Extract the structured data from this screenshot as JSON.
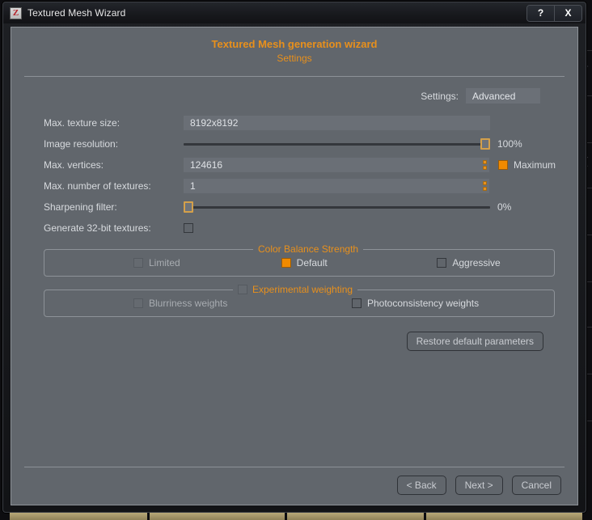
{
  "window": {
    "title": "Textured Mesh Wizard",
    "app_icon": "Z",
    "controls": [
      {
        "name": "help-button",
        "label": "?"
      },
      {
        "name": "close-button",
        "label": "X"
      }
    ]
  },
  "header": {
    "title": "Textured Mesh generation wizard",
    "subtitle": "Settings",
    "accent_color": "#e8901c"
  },
  "preset": {
    "label": "Settings:",
    "value": "Advanced"
  },
  "fields": {
    "texture_size": {
      "label": "Max. texture size:",
      "value": "8192x8192"
    },
    "image_resolution": {
      "label": "Image resolution:",
      "value": "100%",
      "percent": 100
    },
    "max_vertices": {
      "label": "Max. vertices:",
      "value": "124616",
      "maximum_label": "Maximum",
      "maximum_checked": true
    },
    "max_textures": {
      "label": "Max. number of textures:",
      "value": "1"
    },
    "sharpening_filter": {
      "label": "Sharpening filter:",
      "value": "0%",
      "percent": 0
    },
    "generate_32bit": {
      "label": "Generate 32-bit textures:",
      "checked": false
    }
  },
  "color_balance": {
    "title": "Color Balance Strength",
    "options": [
      {
        "label": "Limited",
        "checked": false,
        "dim": true
      },
      {
        "label": "Default",
        "checked": true,
        "dim": false
      },
      {
        "label": "Aggressive",
        "checked": false,
        "dim": false
      }
    ]
  },
  "experimental": {
    "title": "Experimental weighting",
    "enabled": false,
    "options": [
      {
        "label": "Blurriness weights",
        "checked": false,
        "dim": true
      },
      {
        "label": "Photoconsistency weights",
        "checked": false,
        "dim": false
      }
    ]
  },
  "restore_button": "Restore default parameters",
  "footer": {
    "back": "< Back",
    "next": "Next >",
    "cancel": "Cancel"
  }
}
